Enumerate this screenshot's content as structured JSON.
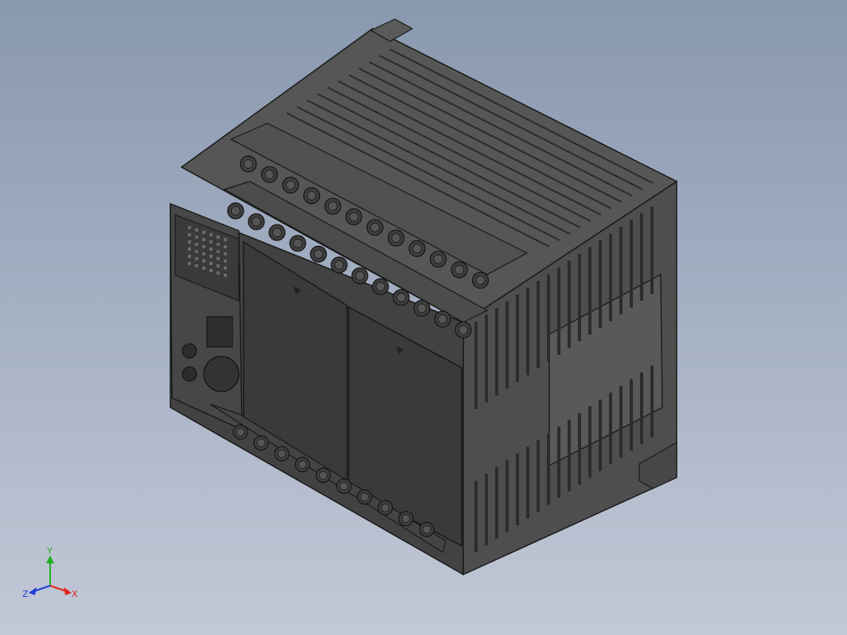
{
  "viewport": {
    "background_top": "#8898ae",
    "background_bottom": "#c2c8d7"
  },
  "model": {
    "body_color": "#4a4a4a",
    "face_color": "#3c3c3c",
    "edge_color": "#1a1a1a",
    "terminals_top_row": 12,
    "terminals_middle_row": 12,
    "terminals_bottom_row": 10
  },
  "triad": {
    "x_label": "X",
    "y_label": "Y",
    "z_label": "Z",
    "x_color": "#e0241b",
    "y_color": "#1fb01f",
    "z_color": "#1f3ed6"
  }
}
